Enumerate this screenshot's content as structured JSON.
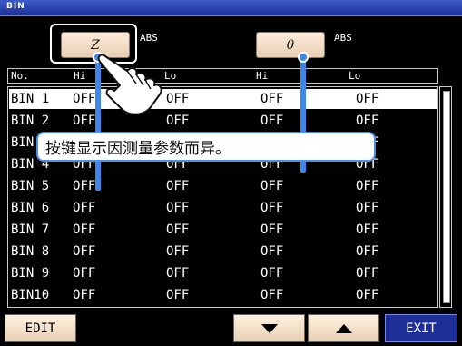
{
  "window": {
    "title": "BIN"
  },
  "params": {
    "param1": {
      "label": "Z",
      "mode": "ABS"
    },
    "param2": {
      "label": "θ",
      "mode": "ABS"
    }
  },
  "header": {
    "no": "No.",
    "hi1": "Hi",
    "lo1": "Lo",
    "hi2": "Hi",
    "lo2": "Lo"
  },
  "rows": [
    {
      "bin": "BIN 1",
      "hi1": "OFF",
      "lo1": "OFF",
      "hi2": "OFF",
      "lo2": "OFF"
    },
    {
      "bin": "BIN 2",
      "hi1": "OFF",
      "lo1": "OFF",
      "hi2": "OFF",
      "lo2": "OFF"
    },
    {
      "bin": "BIN 3",
      "hi1": "OFF",
      "lo1": "OFF",
      "hi2": "OFF",
      "lo2": "OFF"
    },
    {
      "bin": "BIN 4",
      "hi1": "OFF",
      "lo1": "OFF",
      "hi2": "OFF",
      "lo2": "OFF"
    },
    {
      "bin": "BIN 5",
      "hi1": "OFF",
      "lo1": "OFF",
      "hi2": "OFF",
      "lo2": "OFF"
    },
    {
      "bin": "BIN 6",
      "hi1": "OFF",
      "lo1": "OFF",
      "hi2": "OFF",
      "lo2": "OFF"
    },
    {
      "bin": "BIN 7",
      "hi1": "OFF",
      "lo1": "OFF",
      "hi2": "OFF",
      "lo2": "OFF"
    },
    {
      "bin": "BIN 8",
      "hi1": "OFF",
      "lo1": "OFF",
      "hi2": "OFF",
      "lo2": "OFF"
    },
    {
      "bin": "BIN 9",
      "hi1": "OFF",
      "lo1": "OFF",
      "hi2": "OFF",
      "lo2": "OFF"
    },
    {
      "bin": "BIN10",
      "hi1": "OFF",
      "lo1": "OFF",
      "hi2": "OFF",
      "lo2": "OFF"
    }
  ],
  "tooltip": {
    "text": "按键显示因测量参数而异。"
  },
  "footer": {
    "edit": "EDIT",
    "exit": "EXIT"
  },
  "icons": {
    "hand": "pointing-hand-icon",
    "down": "arrow-down-icon",
    "up": "arrow-up-icon"
  },
  "colors": {
    "accent": "#3e87e8",
    "titlebar": "#2a44b4",
    "exit_bg": "#1f2f9a",
    "button_bg": "#f4dfc8"
  }
}
